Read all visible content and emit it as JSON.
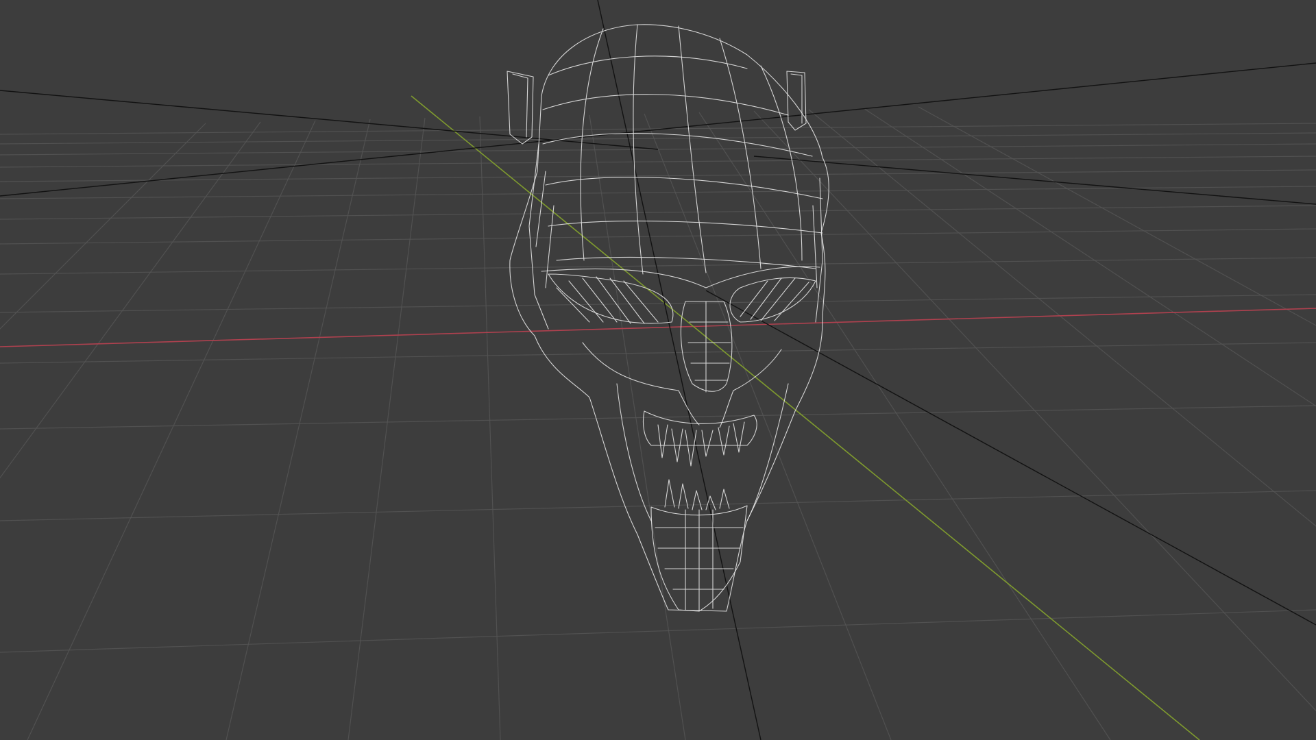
{
  "viewport": {
    "mode": "wireframe",
    "background_color": "#3d3d3d",
    "grid_color": "#555555",
    "x_axis_color": "#b0414f",
    "y_axis_color": "#7f9b2e",
    "guide_line_color": "#121212",
    "wireframe_color": "#e6e6e6"
  },
  "scene": {
    "object": {
      "name": "demon-skull-mesh",
      "display": "wireframe"
    }
  }
}
